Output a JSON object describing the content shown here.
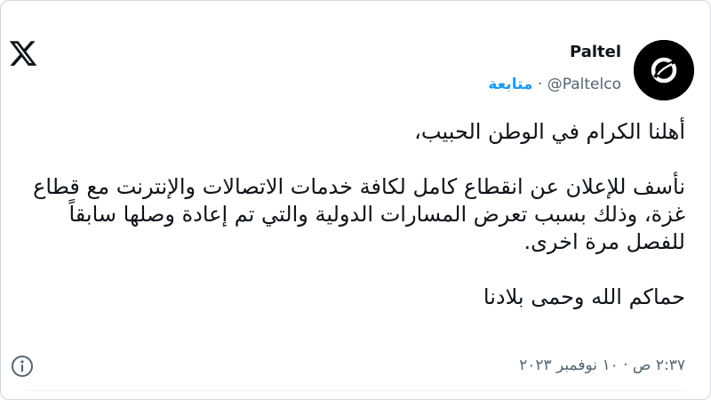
{
  "header": {
    "logo_icon": "x-logo-icon",
    "account_name": "Paltel",
    "handle": "@Paltelco",
    "separator": "·",
    "follow_label": "متابعة",
    "avatar_icon": "paltel-logo-avatar"
  },
  "tweet": {
    "greeting": "أهلنا الكرام في الوطن الحبيب،",
    "body": "نأسف للإعلان عن انقطاع كامل لكافة خدمات الاتصالات والإنترنت مع قطاع غزة، وذلك بسبب تعرض المسارات الدولية والتي تم إعادة وصلها سابقاً للفصل مرة اخرى.",
    "closing": "حماكم الله وحمى بلادنا"
  },
  "footer": {
    "timestamp": "٢:٣٧ ص · ١٠ نوفمبر ٢٠٢٣",
    "info_icon": "info-icon"
  },
  "colors": {
    "accent": "#1d9bf0",
    "text": "#0f1419",
    "secondary": "#536471",
    "border": "#cfd9de"
  }
}
